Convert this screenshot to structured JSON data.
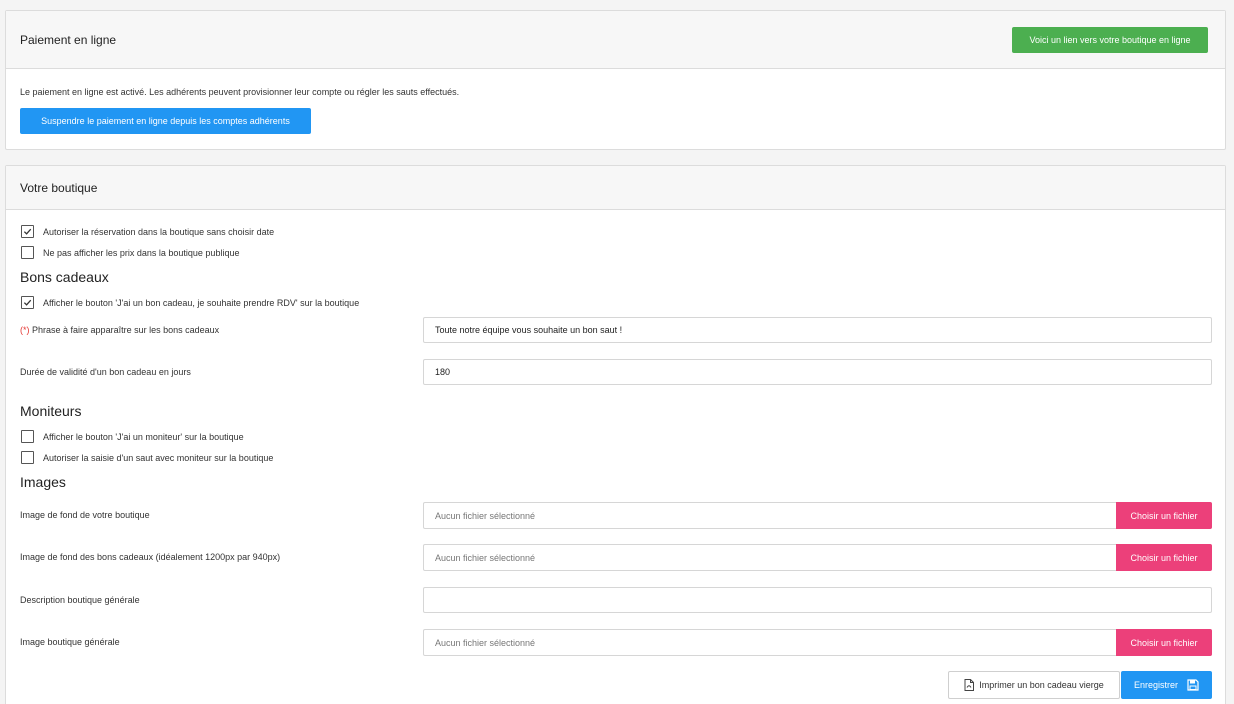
{
  "payment": {
    "title": "Paiement en ligne",
    "shop_link_button": "Voici un lien vers votre boutique en ligne",
    "status_text": "Le paiement en ligne est activé. Les adhérents peuvent provisionner leur compte ou régler les sauts effectués.",
    "suspend_button": "Suspendre le paiement en ligne depuis les comptes adhérents"
  },
  "shop": {
    "title": "Votre boutique",
    "options": [
      {
        "label": "Autoriser la réservation dans la boutique sans choisir date",
        "checked": true
      },
      {
        "label": "Ne pas afficher les prix dans la boutique publique",
        "checked": false
      }
    ],
    "gift": {
      "heading": "Bons cadeaux",
      "show_button_option": {
        "label": "Afficher le bouton 'J'ai un bon cadeau, je souhaite prendre RDV' sur la boutique",
        "checked": true
      },
      "phrase_required_marker": "(*)",
      "phrase_label": "Phrase à faire apparaître sur les bons cadeaux",
      "phrase_value": "Toute notre équipe vous souhaite un bon saut !",
      "validity_label": "Durée de validité d'un bon cadeau en jours",
      "validity_value": "180"
    },
    "instructors": {
      "heading": "Moniteurs",
      "options": [
        {
          "label": "Afficher le bouton 'J'ai un moniteur' sur la boutique",
          "checked": false
        },
        {
          "label": "Autoriser la saisie d'un saut avec moniteur sur la boutique",
          "checked": false
        }
      ]
    },
    "images": {
      "heading": "Images",
      "no_file_text": "Aucun fichier sélectionné",
      "choose_file_button": "Choisir un fichier",
      "shop_background_label": "Image de fond de votre boutique",
      "gift_background_label": "Image de fond des bons cadeaux (idéalement 1200px par 940px)",
      "description_label": "Description boutique générale",
      "description_value": "",
      "general_image_label": "Image boutique générale"
    },
    "footer": {
      "print_button": "Imprimer un bon cadeau vierge",
      "save_button": "Enregistrer"
    }
  },
  "colors": {
    "green": "#4caf50",
    "blue": "#2196f3",
    "pink": "#ec407a"
  }
}
